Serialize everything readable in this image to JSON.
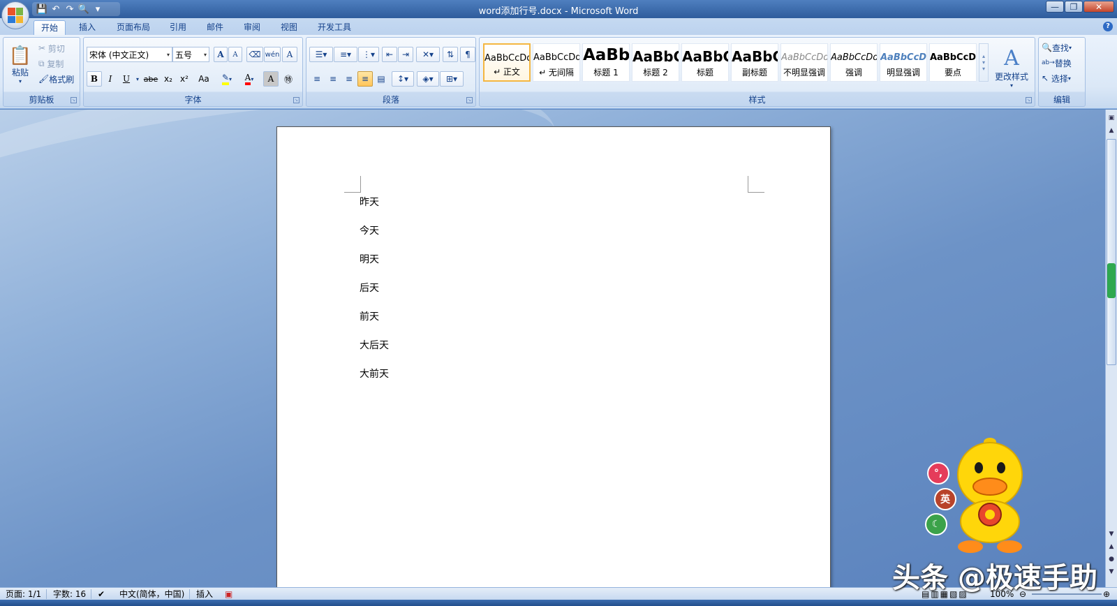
{
  "window": {
    "title": "word添加行号.docx - Microsoft Word",
    "controls": [
      "—",
      "❐",
      "✕"
    ]
  },
  "quick_access": {
    "icons": [
      "save-icon",
      "undo-icon",
      "redo-icon",
      "print-preview-icon",
      "customize-icon"
    ]
  },
  "tabs": [
    "开始",
    "插入",
    "页面布局",
    "引用",
    "邮件",
    "审阅",
    "视图",
    "开发工具"
  ],
  "active_tab": "开始",
  "ribbon": {
    "clipboard": {
      "label": "剪贴板",
      "paste": "粘贴",
      "cut": "剪切",
      "copy": "复制",
      "format_painter": "格式刷"
    },
    "font": {
      "label": "字体",
      "font_name": "宋体 (中文正文)",
      "font_size": "五号",
      "grow": "A",
      "shrink": "A",
      "bold": "B",
      "italic": "I",
      "underline": "U",
      "strikethrough": "abe",
      "subscript": "x₂",
      "superscript": "x²",
      "change_case": "Aa",
      "char_shading": "A",
      "phonetic": "wén",
      "char_border": "A"
    },
    "paragraph": {
      "label": "段落"
    },
    "styles": {
      "label": "样式",
      "items": [
        {
          "sample": "AaBbCcDd",
          "name": "↵ 正文"
        },
        {
          "sample": "AaBbCcDd",
          "name": "↵ 无间隔"
        },
        {
          "sample": "AaBb",
          "name": "标题 1"
        },
        {
          "sample": "AaBbC",
          "name": "标题 2"
        },
        {
          "sample": "AaBbC",
          "name": "标题"
        },
        {
          "sample": "AaBbC",
          "name": "副标题"
        },
        {
          "sample": "AaBbCcDd",
          "name": "不明显强调"
        },
        {
          "sample": "AaBbCcDd",
          "name": "强调"
        },
        {
          "sample": "AaBbCcDd",
          "name": "明显强调"
        },
        {
          "sample": "AaBbCcDd",
          "name": "要点"
        }
      ],
      "change_styles": "更改样式"
    },
    "editing": {
      "label": "编辑",
      "find": "查找",
      "replace": "替换",
      "select": "选择"
    }
  },
  "document": {
    "paragraphs": [
      "昨天",
      "今天",
      "明天",
      "后天",
      "前天",
      "大后天",
      "大前天"
    ]
  },
  "status": {
    "page": "页面: 1/1",
    "words": "字数: 16",
    "language": "中文(简体，中国)",
    "mode": "插入",
    "zoom": "100%"
  },
  "overlay": {
    "watermark": "头条 @极速手助",
    "bubble_english": "英",
    "bubble_punct": "°,"
  },
  "colors": {
    "accent": "#15428b",
    "highlight": "#ffff00",
    "font_color": "#ff0000"
  }
}
